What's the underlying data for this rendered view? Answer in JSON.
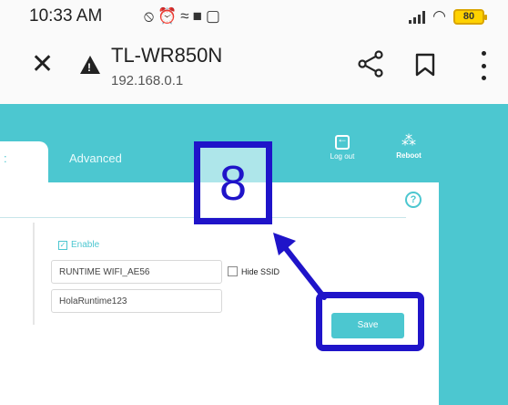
{
  "status_bar": {
    "time": "10:33 AM",
    "notification_icons": [
      "do-not-disturb-icon",
      "alarm-icon",
      "wifi-calling-icon",
      "video-icon",
      "screenshot-icon"
    ],
    "battery": "80"
  },
  "browser": {
    "site_title": "TL-WR850N",
    "url": "192.168.0.1",
    "security_icon": "warning-icon"
  },
  "router_ui": {
    "tabs": [
      {
        "label": ":"
      },
      {
        "label": "Advanced"
      }
    ],
    "logout_label": "Log out",
    "reboot_label": "Reboot",
    "help_glyph": "?",
    "enable_label": "Enable",
    "ssid_value": "RUNTIME WIFI_AE56",
    "hide_ssid_label": "Hide SSID",
    "password_value": "HolaRuntime123",
    "save_label": "Save",
    "accent_color": "#4cc7d0"
  },
  "annotation": {
    "step_number": "8",
    "color": "#1f14c9"
  }
}
